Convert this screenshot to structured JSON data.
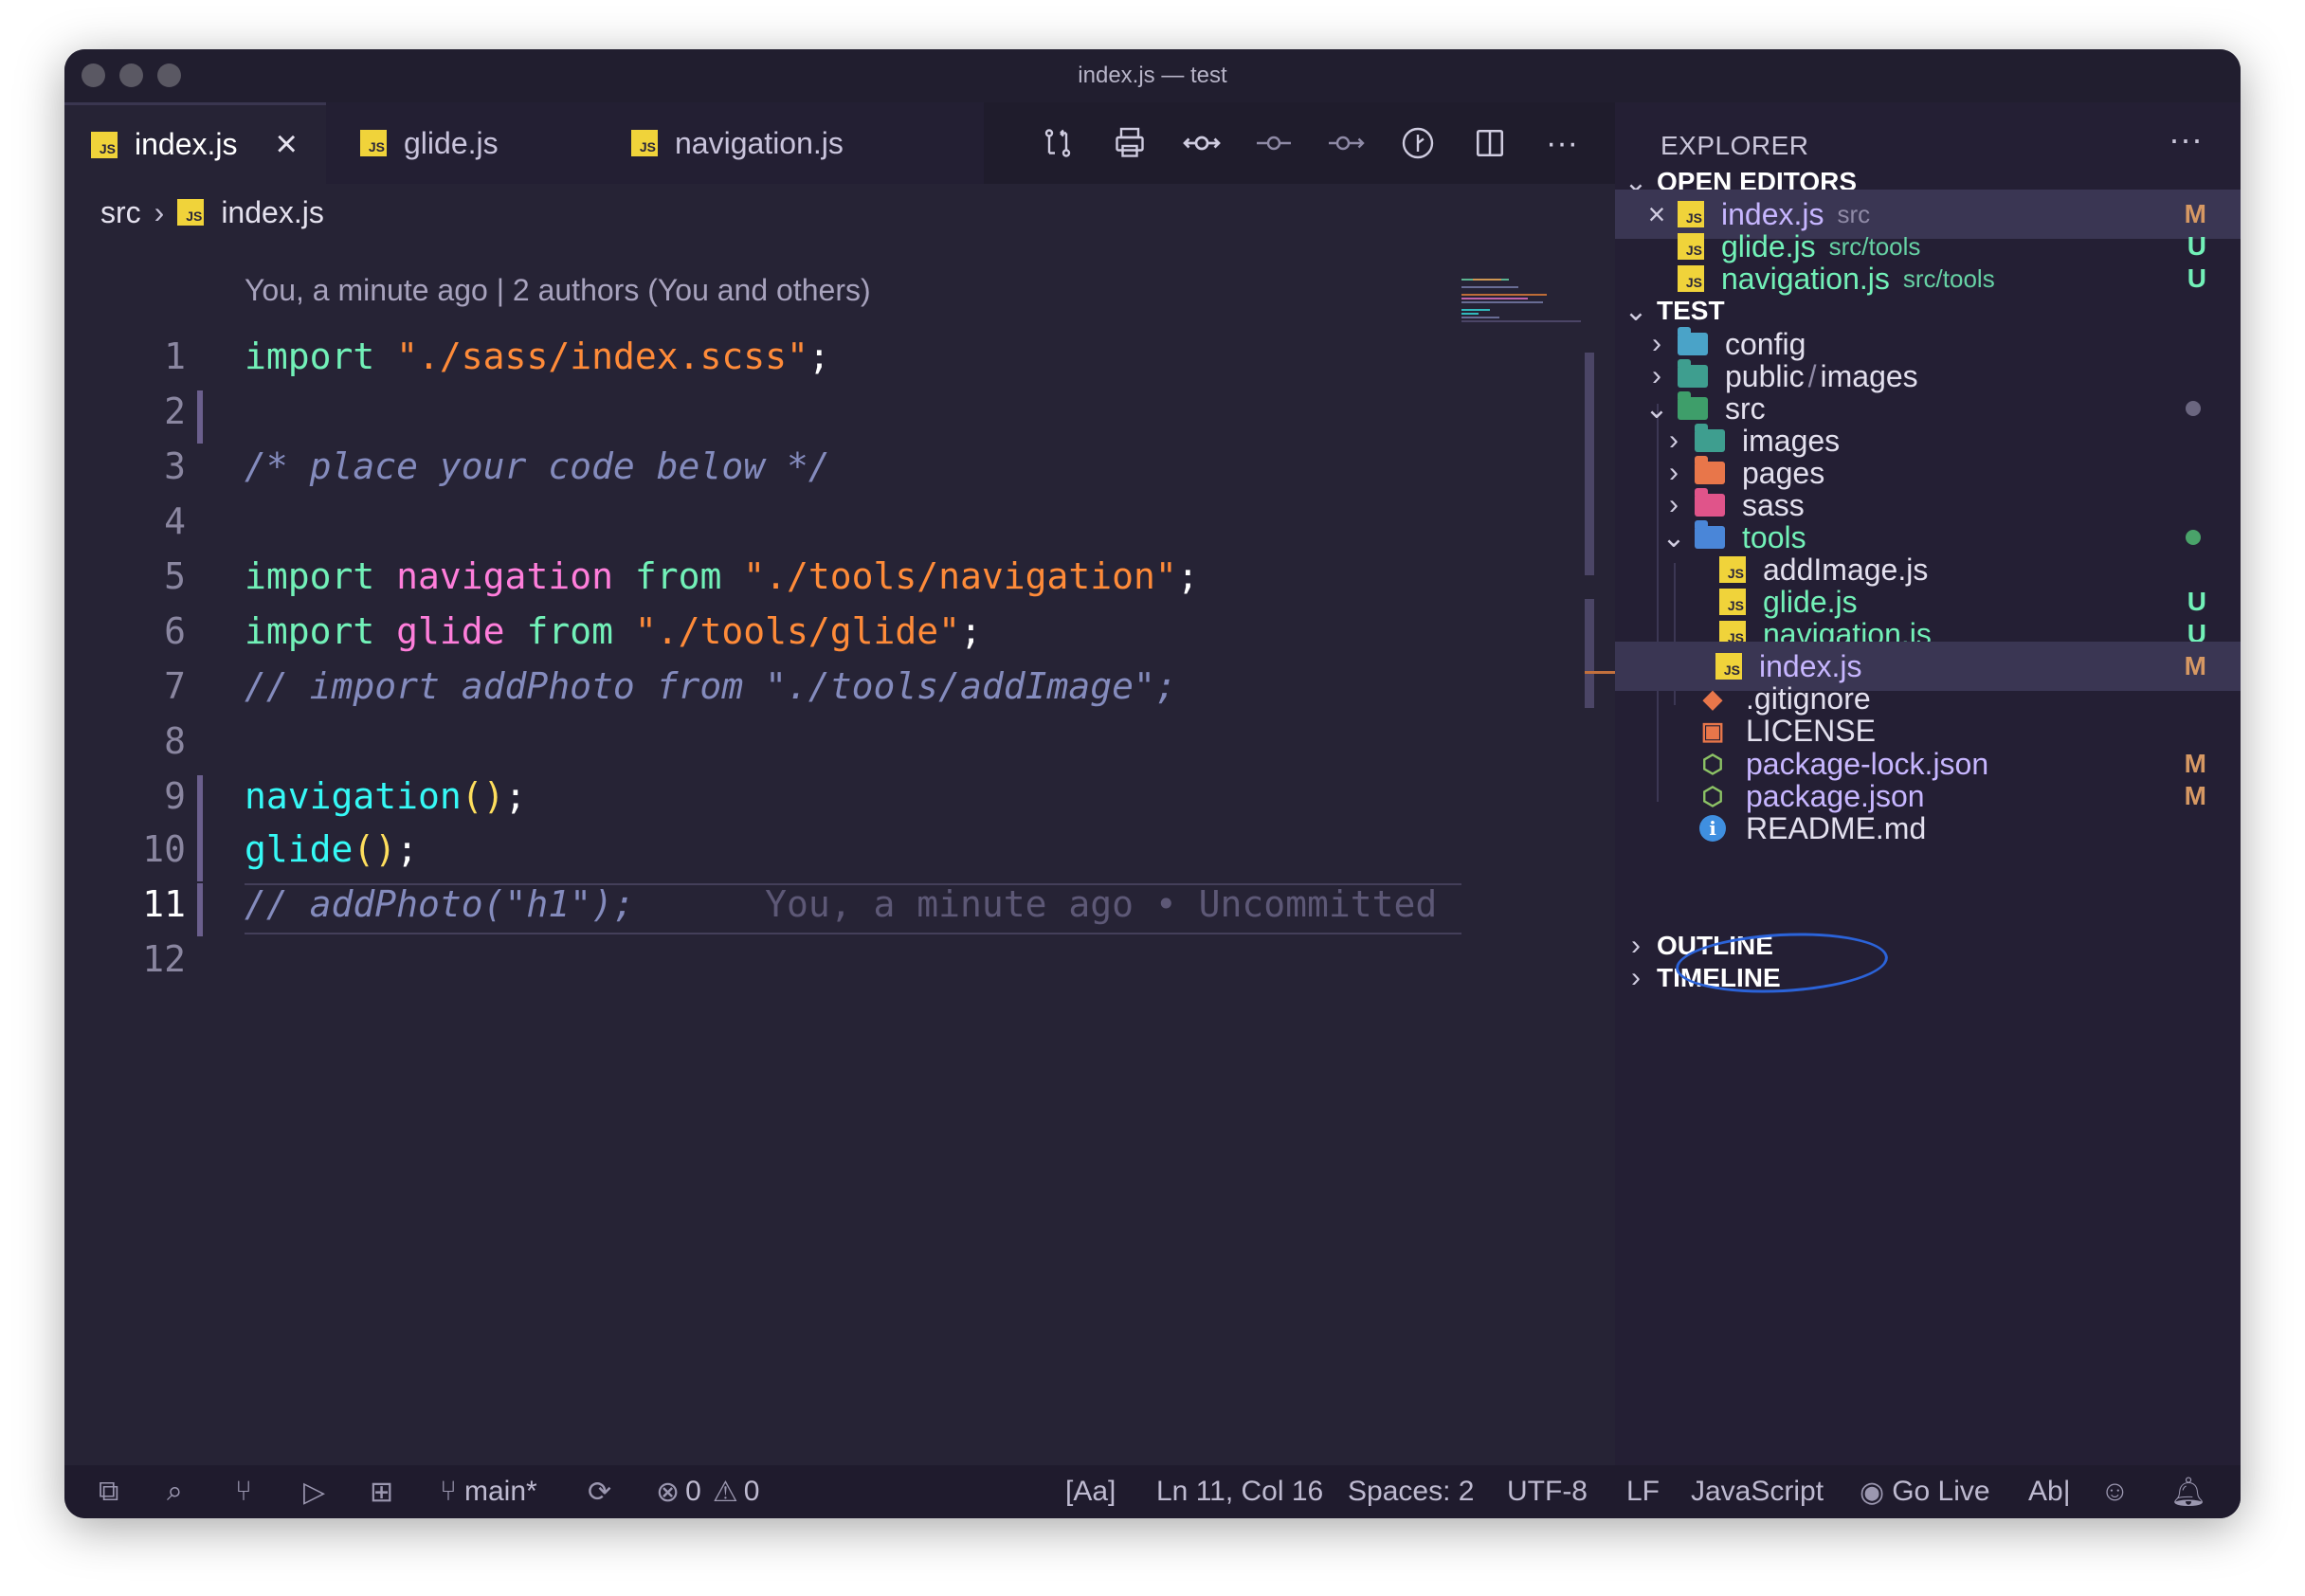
{
  "window": {
    "title": "index.js — test"
  },
  "tabs": [
    {
      "label": "index.js",
      "icon": "js-file-icon",
      "active": true
    },
    {
      "label": "glide.js",
      "icon": "js-file-icon"
    },
    {
      "label": "navigation.js",
      "icon": "js-file-icon"
    }
  ],
  "toolbar": {
    "icons": [
      "compare-changes-icon",
      "print-icon",
      "git-commit-icon",
      "previous-change-icon",
      "next-change-icon",
      "timeline-icon",
      "split-editor-icon",
      "more-actions-icon"
    ]
  },
  "breadcrumb": {
    "folder": "src",
    "file": "index.js"
  },
  "editor": {
    "blame_header": "You, a minute ago | 2 authors (You and others)",
    "current_line_blame": "You, a minute ago • Uncommitted",
    "line_numbers": [
      "1",
      "2",
      "3",
      "4",
      "5",
      "6",
      "7",
      "8",
      "9",
      "10",
      "11",
      "12"
    ],
    "lines": {
      "l1": {
        "kw": "import",
        "str": "\"./sass/index.scss\"",
        "end": ";"
      },
      "l3": {
        "comment": "/* place your code below */"
      },
      "l5": {
        "kw1": "import",
        "var": "navigation",
        "kw2": "from",
        "str": "\"./tools/navigation\"",
        "end": ";"
      },
      "l6": {
        "kw1": "import",
        "var": "glide",
        "kw2": "from",
        "str": "\"./tools/glide\"",
        "end": ";"
      },
      "l7": {
        "comment": "// import addPhoto from \"./tools/addImage\";"
      },
      "l9": {
        "fn": "navigation",
        "paren": "()",
        "end": ";"
      },
      "l10": {
        "fn": "glide",
        "paren": "()",
        "end": ";"
      },
      "l11": {
        "comment": "// addPhoto(\"h1\");"
      }
    }
  },
  "explorer": {
    "header": "EXPLORER",
    "more": "···",
    "open_editors": {
      "title": "OPEN EDITORS",
      "items": [
        {
          "name": "index.js",
          "path": "src",
          "badge": "M"
        },
        {
          "name": "glide.js",
          "path": "src/tools",
          "badge": "U"
        },
        {
          "name": "navigation.js",
          "path": "src/tools",
          "badge": "U"
        }
      ]
    },
    "project": {
      "title": "TEST",
      "items": {
        "config": "config",
        "public": "public",
        "public_sep": "/",
        "images_sub": "images",
        "src": "src",
        "images": "images",
        "pages": "pages",
        "sass": "sass",
        "tools": "tools",
        "addimage": "addImage.js",
        "glide": "glide.js",
        "glide_badge": "U",
        "navigation": "navigation.js",
        "navigation_badge": "U",
        "index": "index.js",
        "index_badge": "M",
        "gitignore": ".gitignore",
        "license": "LICENSE",
        "package_lock": "package-lock.json",
        "package_lock_badge": "M",
        "package": "package.json",
        "package_badge": "M",
        "readme": "README.md"
      }
    },
    "outline": "OUTLINE",
    "timeline": "TIMELINE"
  },
  "statusbar": {
    "branch": "main*",
    "errors": "0",
    "warnings": "0",
    "case": "[Aa]",
    "position": "Ln 11, Col 16",
    "spaces": "Spaces: 2",
    "encoding": "UTF-8",
    "eol": "LF",
    "language": "JavaScript",
    "golive": "Go Live",
    "spell": "Ab|"
  },
  "colors": {
    "background": "#262335",
    "keyword": "#72f1b8",
    "string": "#ff8b39",
    "variable": "#ff7edb",
    "function": "#36f9f6",
    "comment": "#848bbd",
    "modified_badge": "#d69863",
    "untracked_badge": "#72f1b8",
    "annotation_circle": "#2b63d9"
  }
}
